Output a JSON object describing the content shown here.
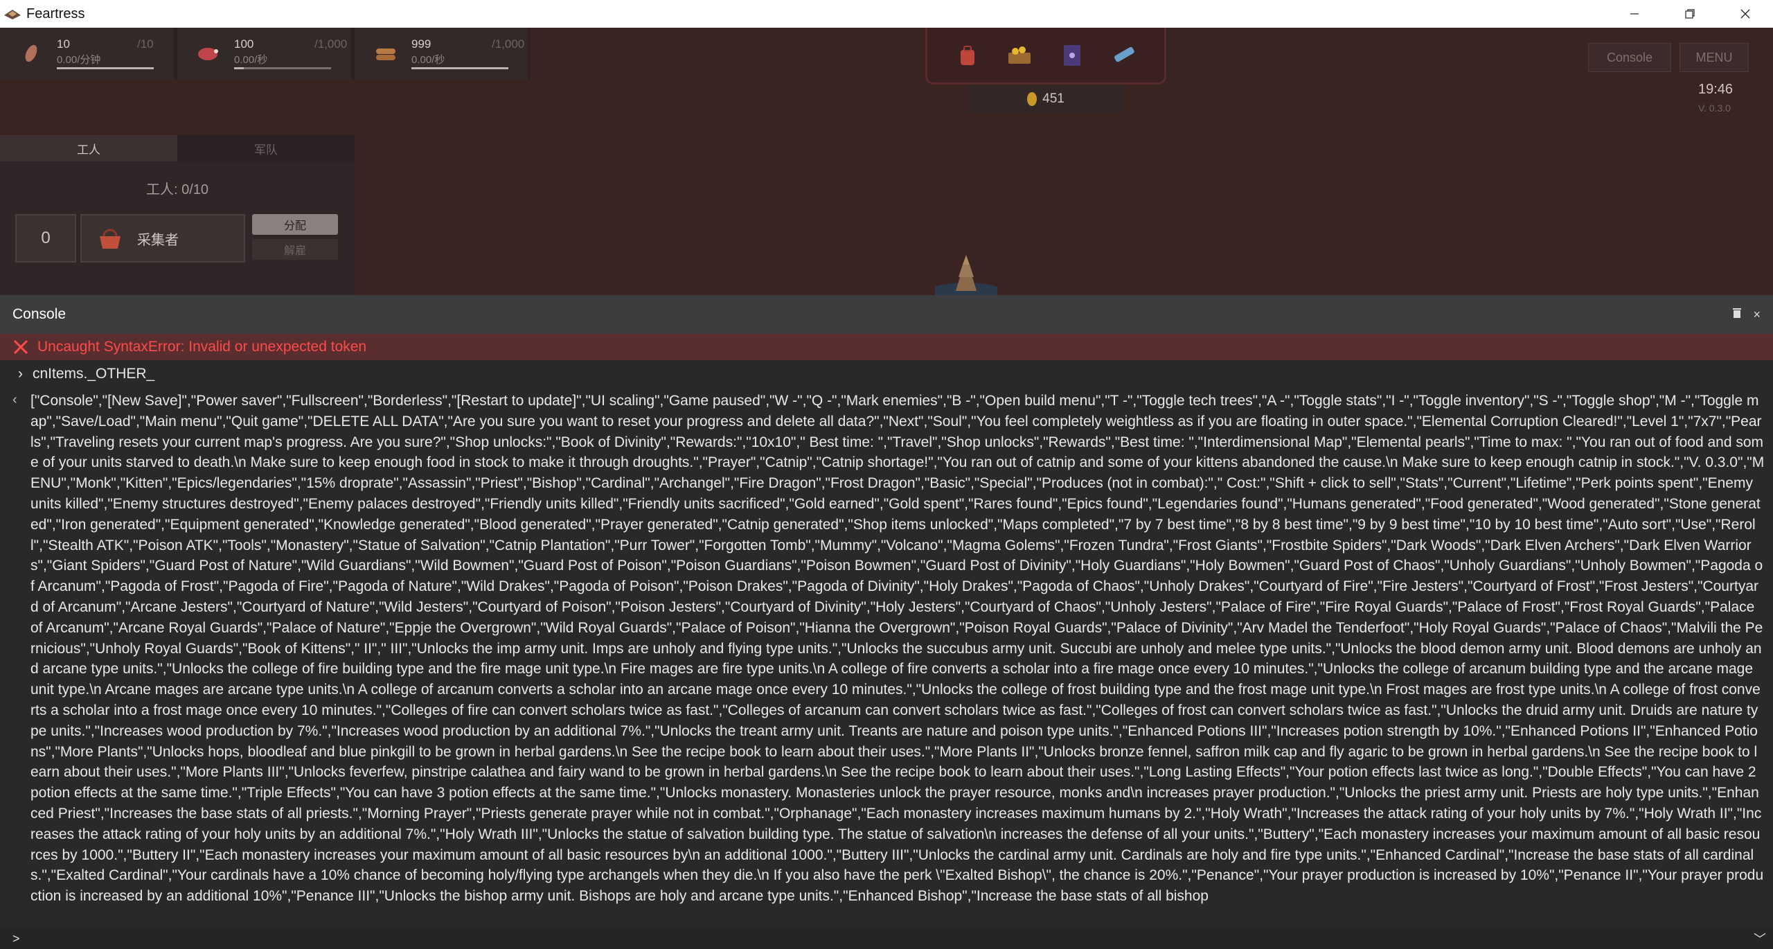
{
  "window": {
    "title": "Feartress",
    "minimize_label": "—",
    "restore_label": "❐",
    "close_label": "✕"
  },
  "resources": [
    {
      "name": "food-icon",
      "value": "10",
      "max": "/10",
      "rate": "0.00/分钟",
      "fill_fraction": 1.0
    },
    {
      "name": "meat-icon",
      "value": "100",
      "max": "/1,000",
      "rate": "0.00/秒",
      "fill_fraction": 0.1
    },
    {
      "name": "wood-icon",
      "value": "999",
      "max": "/1,000",
      "rate": "0.00/秒",
      "fill_fraction": 0.999
    }
  ],
  "toolbar_icons": [
    "backpack-icon",
    "treasure-icon",
    "spellbook-icon",
    "map-scroll-icon"
  ],
  "coins": "451",
  "buttons": {
    "console": "Console",
    "menu": "MENU"
  },
  "clock": "19:46",
  "version": "V. 0.3.0",
  "left_panel": {
    "tabs": [
      {
        "label": "工人",
        "active": true
      },
      {
        "label": "军队",
        "active": false
      }
    ],
    "workers": "工人: 0/10",
    "gatherer": {
      "count": "0",
      "label": "采集者",
      "assign": "分配",
      "dismiss": "解雇"
    }
  },
  "console": {
    "title": "Console",
    "clear_icon": "trash-icon",
    "close_label": "×",
    "error": "Uncaught SyntaxError: Invalid or unexpected token",
    "command": "cnItems._OTHER_",
    "output": "[\"Console\",\"[New Save]\",\"Power saver\",\"Fullscreen\",\"Borderless\",\"[Restart to update]\",\"UI scaling\",\"Game paused\",\"W -\",\"Q -\",\"Mark enemies\",\"B -\",\"Open build menu\",\"T -\",\"Toggle tech trees\",\"A -\",\"Toggle stats\",\"I -\",\"Toggle inventory\",\"S -\",\"Toggle shop\",\"M -\",\"Toggle map\",\"Save/Load\",\"Main menu\",\"Quit game\",\"DELETE ALL DATA\",\"Are you sure you want to reset your progress and delete all data?\",\"Next\",\"Soul\",\"You feel completely weightless as if you are floating in outer space.\",\"Elemental Corruption Cleared!\",\"Level 1\",\"7x7\",\"Pearls\",\"Traveling resets your current map's progress. Are you sure?\",\"Shop unlocks:\",\"Book of Divinity\",\"Rewards:\",\"10x10\",\" Best time: \",\"Travel\",\"Shop unlocks\",\"Rewards\",\"Best time: \",\"Interdimensional Map\",\"Elemental pearls\",\"Time to max: \",\"You ran out of food and some of your units starved to death.\\n Make sure to keep enough food in stock to make it through droughts.\",\"Prayer\",\"Catnip\",\"Catnip shortage!\",\"You ran out of catnip and some of your kittens abandoned the cause.\\n Make sure to keep enough catnip in stock.\",\"V. 0.3.0\",\"MENU\",\"Monk\",\"Kitten\",\"Epics/legendaries\",\"15% droprate\",\"Assassin\",\"Priest\",\"Bishop\",\"Cardinal\",\"Archangel\",\"Fire Dragon\",\"Frost Dragon\",\"Basic\",\"Special\",\"Produces (not in combat):\",\" Cost:\",\"Shift + click to sell\",\"Stats\",\"Current\",\"Lifetime\",\"Perk points spent\",\"Enemy units killed\",\"Enemy structures destroyed\",\"Enemy palaces destroyed\",\"Friendly units killed\",\"Friendly units sacrificed\",\"Gold earned\",\"Gold spent\",\"Rares found\",\"Epics found\",\"Legendaries found\",\"Humans generated\",\"Food generated\",\"Wood generated\",\"Stone generated\",\"Iron generated\",\"Equipment generated\",\"Knowledge generated\",\"Blood generated\",\"Prayer generated\",\"Catnip generated\",\"Shop items unlocked\",\"Maps completed\",\"7 by 7 best time\",\"8 by 8 best time\",\"9 by 9 best time\",\"10 by 10 best time\",\"Auto sort\",\"Use\",\"Reroll\",\"Stealth ATK\",\"Poison ATK\",\"Tools\",\"Monastery\",\"Statue of Salvation\",\"Catnip Plantation\",\"Purr Tower\",\"Forgotten Tomb\",\"Mummy\",\"Volcano\",\"Magma Golems\",\"Frozen Tundra\",\"Frost Giants\",\"Frostbite Spiders\",\"Dark Woods\",\"Dark Elven Archers\",\"Dark Elven Warriors\",\"Giant Spiders\",\"Guard Post of Nature\",\"Wild Guardians\",\"Wild Bowmen\",\"Guard Post of Poison\",\"Poison Guardians\",\"Poison Bowmen\",\"Guard Post of Divinity\",\"Holy Guardians\",\"Holy Bowmen\",\"Guard Post of Chaos\",\"Unholy Guardians\",\"Unholy Bowmen\",\"Pagoda of Arcanum\",\"Pagoda of Frost\",\"Pagoda of Fire\",\"Pagoda of Nature\",\"Wild Drakes\",\"Pagoda of Poison\",\"Poison Drakes\",\"Pagoda of Divinity\",\"Holy Drakes\",\"Pagoda of Chaos\",\"Unholy Drakes\",\"Courtyard of Fire\",\"Fire Jesters\",\"Courtyard of Frost\",\"Frost Jesters\",\"Courtyard of Arcanum\",\"Arcane Jesters\",\"Courtyard of Nature\",\"Wild Jesters\",\"Courtyard of Poison\",\"Poison Jesters\",\"Courtyard of Divinity\",\"Holy Jesters\",\"Courtyard of Chaos\",\"Unholy Jesters\",\"Palace of Fire\",\"Fire Royal Guards\",\"Palace of Frost\",\"Frost Royal Guards\",\"Palace of Arcanum\",\"Arcane Royal Guards\",\"Palace of Nature\",\"Eppje the Overgrown\",\"Wild Royal Guards\",\"Palace of Poison\",\"Hianna the Overgrown\",\"Poison Royal Guards\",\"Palace of Divinity\",\"Arv Madel the Tenderfoot\",\"Holy Royal Guards\",\"Palace of Chaos\",\"Malvili the Pernicious\",\"Unholy Royal Guards\",\"Book of Kittens\",\" II\",\" III\",\"Unlocks the imp army unit. Imps are unholy and flying type units.\",\"Unlocks the succubus army unit. Succubi are unholy and melee type units.\",\"Unlocks the blood demon army unit. Blood demons are unholy and arcane type units.\",\"Unlocks the college of fire building type and the fire mage unit type.\\n Fire mages are fire type units.\\n A college of fire converts a scholar into a fire mage once every 10 minutes.\",\"Unlocks the college of arcanum building type and the arcane mage unit type.\\n Arcane mages are arcane type units.\\n A college of arcanum converts a scholar into an arcane mage once every 10 minutes.\",\"Unlocks the college of frost building type and the frost mage unit type.\\n Frost mages are frost type units.\\n A college of frost converts a scholar into a frost mage once every 10 minutes.\",\"Colleges of fire can convert scholars twice as fast.\",\"Colleges of arcanum can convert scholars twice as fast.\",\"Colleges of frost can convert scholars twice as fast.\",\"Unlocks the druid army unit. Druids are nature type units.\",\"Increases wood production by 7%.\",\"Increases wood production by an additional 7%.\",\"Unlocks the treant army unit. Treants are nature and poison type units.\",\"Enhanced Potions III\",\"Increases potion strength by 10%.\",\"Enhanced Potions II\",\"Enhanced Potions\",\"More Plants\",\"Unlocks hops, bloodleaf and blue pinkgill to be grown in herbal gardens.\\n See the recipe book to learn about their uses.\",\"More Plants II\",\"Unlocks bronze fennel, saffron milk cap and fly agaric to be grown in herbal gardens.\\n See the recipe book to learn about their uses.\",\"More Plants III\",\"Unlocks feverfew, pinstripe calathea and fairy wand to be grown in herbal gardens.\\n See the recipe book to learn about their uses.\",\"Long Lasting Effects\",\"Your potion effects last twice as long.\",\"Double Effects\",\"You can have 2 potion effects at the same time.\",\"Triple Effects\",\"You can have 3 potion effects at the same time.\",\"Unlocks monastery. Monasteries unlock the prayer resource, monks and\\n increases prayer production.\",\"Unlocks the priest army unit. Priests are holy type units.\",\"Enhanced Priest\",\"Increases the base stats of all priests.\",\"Morning Prayer\",\"Priests generate prayer while not in combat.\",\"Orphanage\",\"Each monastery increases maximum humans by 2.\",\"Holy Wrath\",\"Increases the attack rating of your holy units by 7%.\",\"Holy Wrath II\",\"Increases the attack rating of your holy units by an additional 7%.\",\"Holy Wrath III\",\"Unlocks the statue of salvation building type. The statue of salvation\\n increases the defense of all your units.\",\"Buttery\",\"Each monastery increases your maximum amount of all basic resources by 1000.\",\"Buttery II\",\"Each monastery increases your maximum amount of all basic resources by\\n an additional 1000.\",\"Buttery III\",\"Unlocks the cardinal army unit. Cardinals are holy and fire type units.\",\"Enhanced Cardinal\",\"Increase the base stats of all cardinals.\",\"Exalted Cardinal\",\"Your cardinals have a 10% chance of becoming holy/flying type archangels when they die.\\n If you also have the perk \\\"Exalted Bishop\\\", the chance is 20%.\",\"Penance\",\"Your prayer production is increased by 10%\",\"Penance II\",\"Your prayer production is increased by an additional 10%\",\"Penance III\",\"Unlocks the bishop army unit. Bishops are holy and arcane type units.\",\"Enhanced Bishop\",\"Increase the base stats of all bishop",
    "prompt_glyph": ">",
    "collapse_glyph": "﹀"
  }
}
